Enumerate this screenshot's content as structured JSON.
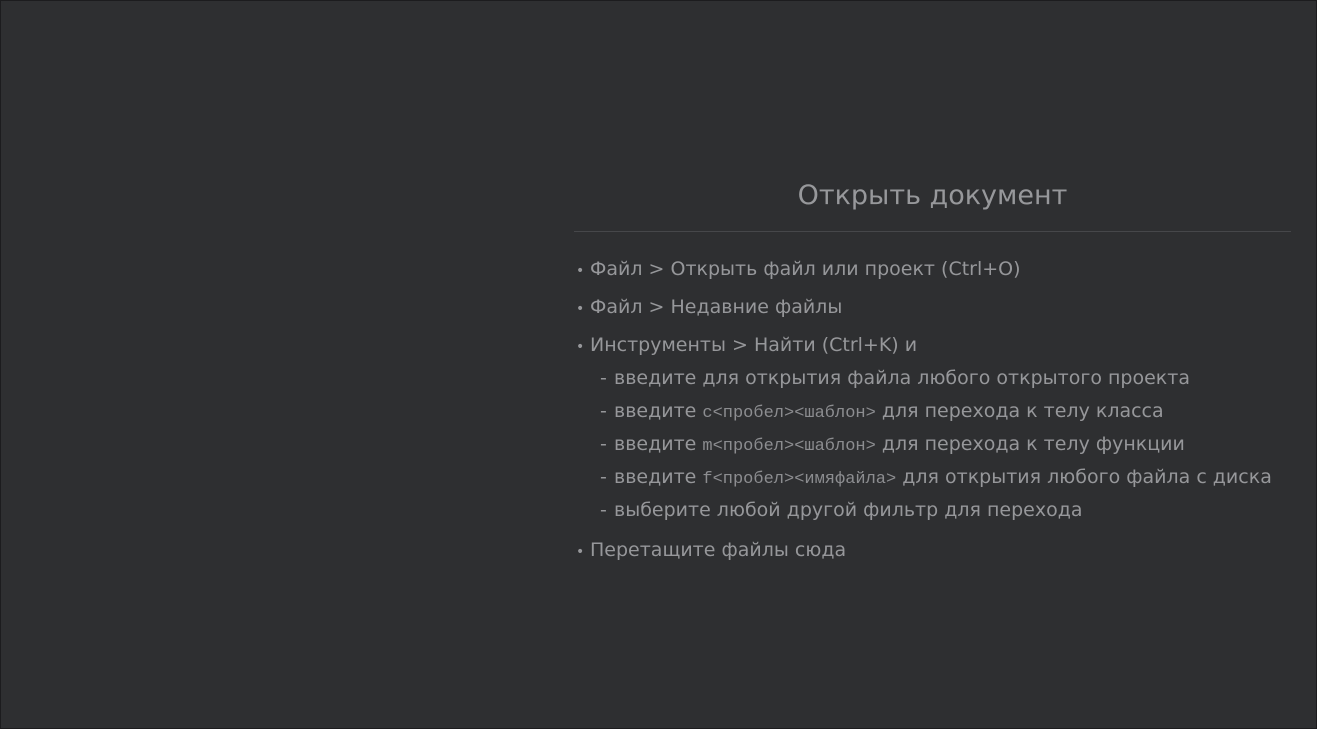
{
  "welcome": {
    "title": "Открыть документ",
    "items": [
      {
        "bullet": "•",
        "text": "Файл > Открыть файл или проект (Ctrl+O)"
      },
      {
        "bullet": "•",
        "text": "Файл > Недавние файлы"
      },
      {
        "bullet": "•",
        "text": "Инструменты > Найти (Ctrl+K) и",
        "subitems": [
          {
            "dash": "-",
            "prefix": "введите для открытия файла любого открытого проекта",
            "code": "",
            "suffix": ""
          },
          {
            "dash": "-",
            "prefix": "введите ",
            "code": "c<пробел><шаблон>",
            "suffix": " для перехода к телу класса"
          },
          {
            "dash": "-",
            "prefix": "введите ",
            "code": "m<пробел><шаблон>",
            "suffix": " для перехода к телу функции"
          },
          {
            "dash": "-",
            "prefix": "введите ",
            "code": "f<пробел><имяфайла>",
            "suffix": " для открытия любого файла с диска"
          },
          {
            "dash": "-",
            "prefix": "выберите любой другой фильтр для перехода",
            "code": "",
            "suffix": ""
          }
        ]
      },
      {
        "bullet": "•",
        "text": "Перетащите файлы сюда"
      }
    ]
  },
  "colors": {
    "background": "#2e2f31",
    "text": "#96979a",
    "rule": "#46474a"
  }
}
